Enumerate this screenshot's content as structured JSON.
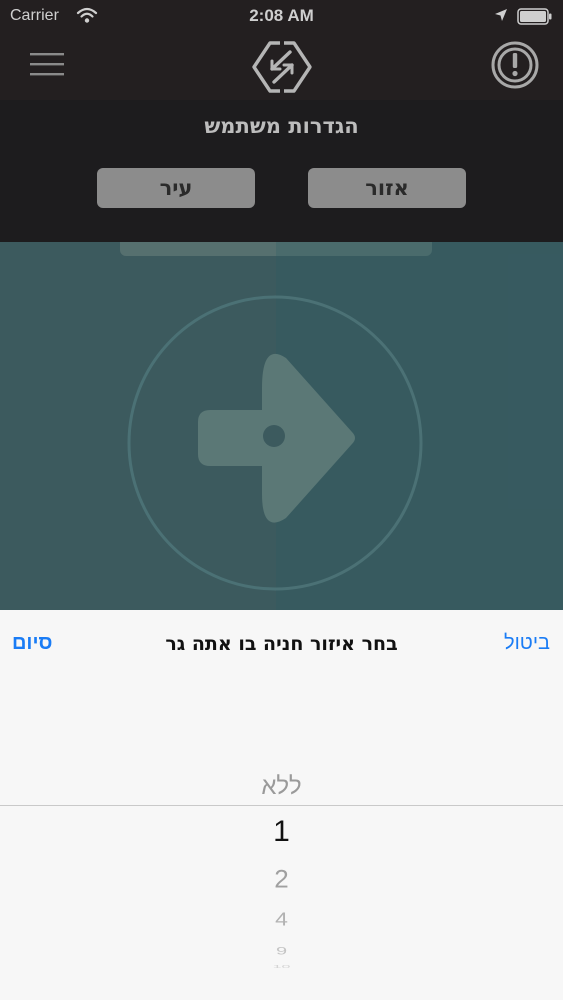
{
  "status_bar": {
    "carrier": "Carrier",
    "time": "2:08 AM",
    "wifi_icon": "wifi-icon",
    "location_icon": "location-arrow-icon",
    "battery_icon": "battery-icon"
  },
  "nav": {
    "menu_icon": "hamburger-menu-icon",
    "logo_icon": "swap-arrows-logo-icon",
    "alert_icon": "exclamation-circle-icon"
  },
  "settings": {
    "title": "הגדרות משתמש",
    "area_label": "אזור",
    "city_label": "עיר"
  },
  "main": {
    "graphic_icon": "parking-direction-arrow-icon"
  },
  "picker": {
    "cancel_label": "ביטול",
    "title": "בחר איזור חניה בו אתה גר",
    "done_label": "סיום",
    "options": [
      "ללא",
      "1",
      "2",
      "4",
      "9",
      "10"
    ],
    "selected": "1"
  },
  "colors": {
    "accent": "#1a7cf5",
    "topbar": "#231f20",
    "header": "#1d1c1e",
    "segment_button": "#8c8c8c",
    "dim_overlay": "#3c5a5e",
    "sheet": "#f7f7f7"
  }
}
